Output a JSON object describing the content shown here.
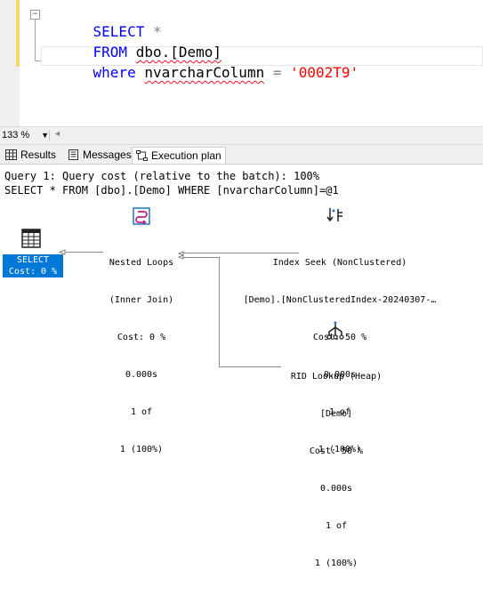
{
  "editor": {
    "line1": {
      "keyword": "SELECT",
      "rest": "*"
    },
    "line2": {
      "keyword": "FROM",
      "table": "dbo.[Demo]"
    },
    "line3": {
      "keyword": "where",
      "column": "nvarcharColumn",
      "operator": "=",
      "value": "'0002T9'"
    }
  },
  "zoom": {
    "value": "133 %"
  },
  "tabs": {
    "results": "Results",
    "messages": "Messages",
    "plan": "Execution plan"
  },
  "plan": {
    "header1": "Query 1: Query cost (relative to the batch): 100%",
    "header2": "SELECT * FROM [dbo].[Demo] WHERE [nvarcharColumn]=@1",
    "select_node": {
      "label": "SELECT",
      "cost": "Cost: 0 %"
    },
    "nested_loops": {
      "title": "Nested Loops",
      "subtitle": "(Inner Join)",
      "cost": "Cost: 0 %",
      "time": "0.000s",
      "rows": "1 of",
      "pct": "1 (100%)"
    },
    "index_seek": {
      "title": "Index Seek (NonClustered)",
      "subtitle": "[Demo].[NonClusteredIndex-20240307-…",
      "cost": "Cost: 50 %",
      "time": "0.000s",
      "rows": "1 of",
      "pct": "1 (100%)"
    },
    "rid_lookup": {
      "title": "RID Lookup (Heap)",
      "subtitle": "[Demo]",
      "cost": "Cost: 50 %",
      "time": "0.000s",
      "rows": "1 of",
      "pct": "1 (100%)"
    }
  },
  "colors": {
    "keyword": "#0000ff",
    "string": "#ff0000",
    "selection": "#0078d7",
    "outline_bar": "#f7d76b"
  }
}
